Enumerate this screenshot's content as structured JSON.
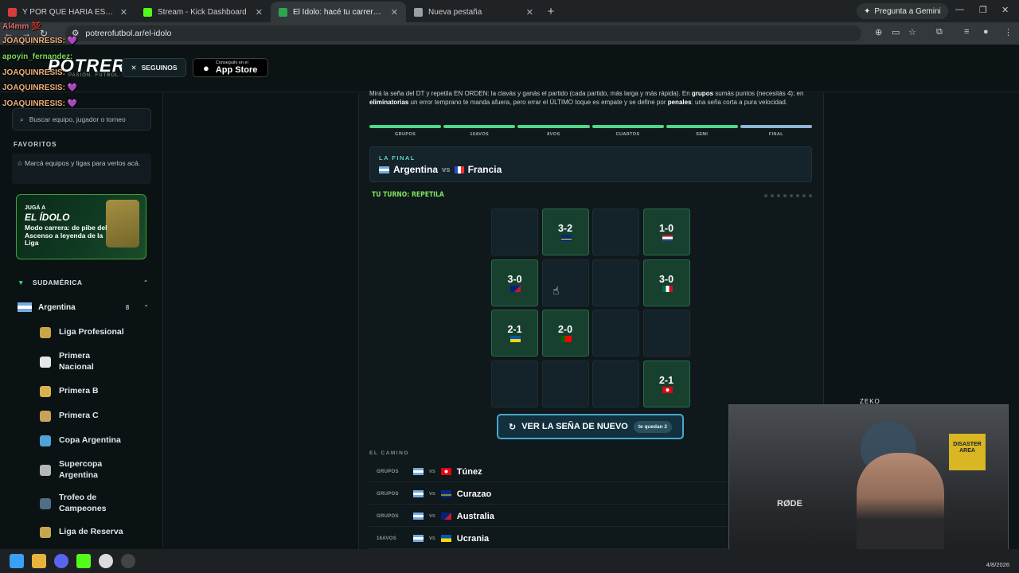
{
  "browser": {
    "tabs": [
      {
        "title": "Y POR QUE HARIA ESO?",
        "favicon_color": "#d83b3b"
      },
      {
        "title": "Stream - Kick Dashboard",
        "favicon_color": "#53fc18"
      },
      {
        "title": "El Ídolo: hacé tu carrera en la Li",
        "favicon_color": "#2ea44f"
      },
      {
        "title": "Nueva pestaña",
        "favicon_color": "#9aa0a6"
      }
    ],
    "gemini_label": "Pregunta a Gemini",
    "url": "potrerofutbol.ar/el-idolo"
  },
  "header": {
    "logo": "POTRERO",
    "logo_sub": "PASIÓN. FÚTBOL.",
    "follow_label": "SEGUINOS",
    "store_small": "Conseguilo en el",
    "store_big": "App Store"
  },
  "chat": [
    {
      "user": "Al4mm",
      "emote": "💯",
      "kind": "ali"
    },
    {
      "user": "JOAQUINRESIS:",
      "emote": "💜",
      "kind": "joa"
    },
    {
      "user": "apoyin_fernandez:",
      "emote": "",
      "kind": "apo"
    },
    {
      "user": "JOAQUINRESIS:",
      "emote": "",
      "kind": "joa"
    },
    {
      "user": "JOAQUINRESIS:",
      "emote": "💜",
      "kind": "joa"
    },
    {
      "user": "JOAQUINRESIS:",
      "emote": "💜",
      "kind": "joa"
    }
  ],
  "sidebar": {
    "search_placeholder": "Buscar equipo, jugador o torneo",
    "favorites_title": "FAVORITOS",
    "favorites_hint": "Marcá equipos y ligas para verlos acá.",
    "promo_kicker": "JUGÁ A",
    "promo_title": "EL ÍDOLO",
    "promo_desc": "Modo carrera: de pibe del Ascenso a leyenda de la Liga",
    "region": "SUDAMÉRICA",
    "country": "Argentina",
    "country_count": "8",
    "leagues": [
      {
        "name": "Liga Profesional",
        "color": "#c9a54a"
      },
      {
        "name": "Primera Nacional",
        "color": "#e6e6e6"
      },
      {
        "name": "Primera B",
        "color": "#d9b24c"
      },
      {
        "name": "Primera C",
        "color": "#c9a25a"
      },
      {
        "name": "Copa Argentina",
        "color": "#4fa3d6"
      },
      {
        "name": "Supercopa Argentina",
        "color": "#b7b7b7"
      },
      {
        "name": "Trofeo de Campeones",
        "color": "#4f6e88"
      },
      {
        "name": "Liga de Reserva",
        "color": "#c4a84e"
      }
    ]
  },
  "game": {
    "intro_parts": [
      {
        "t": "Mirá la seña del DT y repetila EN ORDEN: la clavás y ganás el partido (cada partido, más larga y más rápida). En ",
        "b": false
      },
      {
        "t": "grupos",
        "b": true
      },
      {
        "t": " sumás puntos (necesitás 4); en ",
        "b": false
      },
      {
        "t": "eliminatorias",
        "b": true
      },
      {
        "t": " un error temprano te manda afuera, pero errar el ÚLTIMO toque es empate y se define por ",
        "b": false
      },
      {
        "t": "penales",
        "b": true
      },
      {
        "t": ": una seña corta a pura velocidad.",
        "b": false
      }
    ],
    "stages": [
      "GRUPOS",
      "16AVOS",
      "8VOS",
      "CUARTOS",
      "SEMI",
      "FINAL"
    ],
    "final_label": "LA FINAL",
    "home": "Argentina",
    "vs": "vs",
    "away": "Francia",
    "turn_label": "TU TURNO: REPETILA",
    "progress_dots": {
      "total": 8,
      "done": 0
    },
    "cells": [
      {
        "score": "",
        "flag": ""
      },
      {
        "score": "3-2",
        "flag": "curazao"
      },
      {
        "score": "",
        "flag": ""
      },
      {
        "score": "1-0",
        "flag": "netherlands"
      },
      {
        "score": "3-0",
        "flag": "australia"
      },
      {
        "score": "",
        "flag": ""
      },
      {
        "score": "",
        "flag": ""
      },
      {
        "score": "3-0",
        "flag": "mexico"
      },
      {
        "score": "2-1",
        "flag": "ukraine"
      },
      {
        "score": "2-0",
        "flag": "portugal"
      },
      {
        "score": "",
        "flag": ""
      },
      {
        "score": "",
        "flag": ""
      },
      {
        "score": "",
        "flag": ""
      },
      {
        "score": "",
        "flag": ""
      },
      {
        "score": "",
        "flag": ""
      },
      {
        "score": "2-1",
        "flag": "tunisia"
      }
    ],
    "repeat_label": "VER LA SEÑA DE NUEVO",
    "repeat_badge": "te quedan 2",
    "path_title": "EL CAMINO",
    "path": [
      {
        "stage": "GRUPOS",
        "rival": "Túnez",
        "flag": "tunisia"
      },
      {
        "stage": "GRUPOS",
        "rival": "Curazao",
        "flag": "curazao"
      },
      {
        "stage": "GRUPOS",
        "rival": "Australia",
        "flag": "australia"
      },
      {
        "stage": "16AVOS",
        "rival": "Ucrania",
        "flag": "ukraine"
      }
    ]
  },
  "webcam": {
    "name": "ZEKO",
    "mic_brand": "RØDE",
    "sign": "DISASTER AREA"
  },
  "clock": "4/8/2026"
}
